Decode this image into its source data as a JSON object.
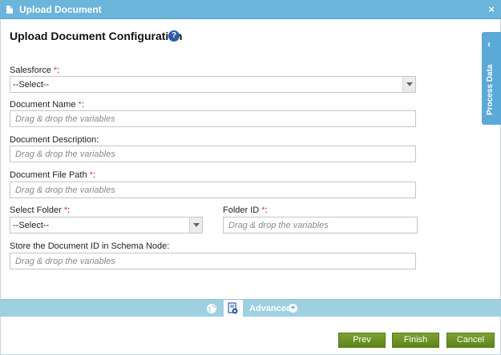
{
  "window": {
    "title": "Upload Document",
    "close_label": "×"
  },
  "heading": {
    "title": "Upload Document Configuration",
    "help_label": "?"
  },
  "fields": {
    "salesforce": {
      "label": "Salesforce",
      "required_mark": "*",
      "suffix": ":",
      "value": "--Select--"
    },
    "document_name": {
      "label": "Document Name",
      "required_mark": "*",
      "suffix": ":",
      "placeholder": "Drag & drop the variables"
    },
    "document_description": {
      "label": "Document Description",
      "suffix": ":",
      "placeholder": "Drag & drop the variables"
    },
    "document_file_path": {
      "label": "Document File Path",
      "required_mark": "*",
      "suffix": ":",
      "placeholder": "Drag & drop the variables"
    },
    "select_folder": {
      "label": "Select Folder",
      "required_mark": "*",
      "suffix": ":",
      "value": "--Select--"
    },
    "folder_id": {
      "label": "Folder ID",
      "required_mark": "*",
      "suffix": ":",
      "placeholder": "Drag & drop the variables"
    },
    "store_document_id": {
      "label": "Store the Document ID in Schema Node",
      "suffix": ":",
      "placeholder": "Drag & drop the variables"
    }
  },
  "process_data": {
    "label": "Process Data",
    "chevron": "‹"
  },
  "advanced": {
    "label": "Advanced",
    "plus": "+"
  },
  "buttons": {
    "prev": "Prev",
    "finish": "Finish",
    "cancel": "Cancel"
  },
  "colors": {
    "titlebar": "#6ab5d9",
    "advbar": "#9fd0e2",
    "button": "#6b8e23",
    "required": "#e23b3b"
  }
}
